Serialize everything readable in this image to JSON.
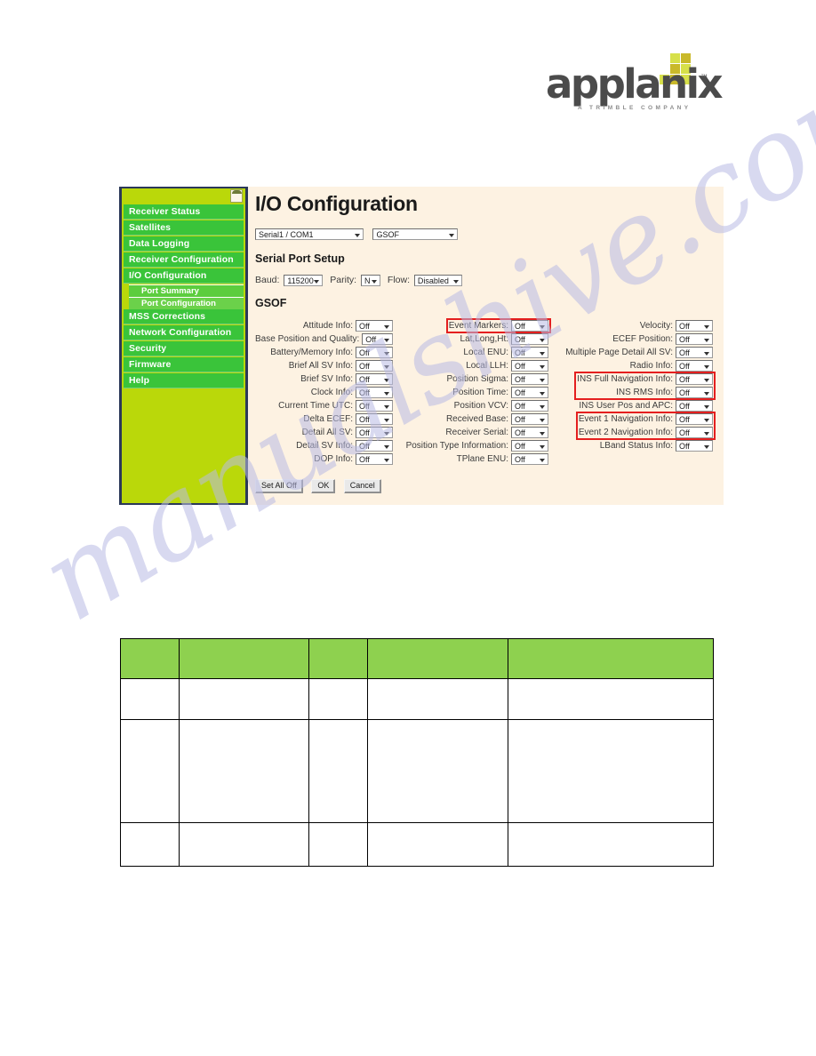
{
  "logo": {
    "wordmark": "applanix",
    "trademark": "™",
    "tagline": "A TRIMBLE COMPANY",
    "block_color_light": "#d7e04a",
    "block_color_dark": "#c9b92a"
  },
  "watermark": {
    "text": "manualshive.com",
    "color": "#b9bbe4"
  },
  "sidebar": {
    "background_color": "#bad80a",
    "item_color": "#3ac43a",
    "items": [
      {
        "label": "Receiver Status",
        "type": "item"
      },
      {
        "label": "Satellites",
        "type": "item"
      },
      {
        "label": "Data Logging",
        "type": "item"
      },
      {
        "label": "Receiver Configuration",
        "type": "item"
      },
      {
        "label": "I/O Configuration",
        "type": "item"
      },
      {
        "label": "Port Summary",
        "type": "sub"
      },
      {
        "label": "Port Configuration",
        "type": "sub-selected"
      },
      {
        "label": "MSS Corrections",
        "type": "item"
      },
      {
        "label": "Network Configuration",
        "type": "item"
      },
      {
        "label": "Security",
        "type": "item"
      },
      {
        "label": "Firmware",
        "type": "item"
      },
      {
        "label": "Help",
        "type": "item"
      }
    ]
  },
  "main": {
    "title": "I/O Configuration",
    "port_select": "Serial1 / COM1",
    "format_select": "GSOF",
    "serial_section_title": "Serial Port Setup",
    "baud_label": "Baud:",
    "baud_value": "115200",
    "parity_label": "Parity:",
    "parity_value": "N",
    "flow_label": "Flow:",
    "flow_value": "Disabled",
    "gsof_section_title": "GSOF",
    "off_value": "Off",
    "columns": [
      {
        "rows": [
          {
            "label": "Attitude Info:",
            "value": "Off",
            "highlight": false
          },
          {
            "label": "Base Position and Quality:",
            "value": "Off",
            "highlight": false
          },
          {
            "label": "Battery/Memory Info:",
            "value": "Off",
            "highlight": false
          },
          {
            "label": "Brief All SV Info:",
            "value": "Off",
            "highlight": false
          },
          {
            "label": "Brief SV Info:",
            "value": "Off",
            "highlight": false
          },
          {
            "label": "Clock Info:",
            "value": "Off",
            "highlight": false
          },
          {
            "label": "Current Time UTC:",
            "value": "Off",
            "highlight": false
          },
          {
            "label": "Delta ECEF:",
            "value": "Off",
            "highlight": false
          },
          {
            "label": "Detail All SV:",
            "value": "Off",
            "highlight": false
          },
          {
            "label": "Detail SV Info:",
            "value": "Off",
            "highlight": false
          },
          {
            "label": "DOP Info:",
            "value": "Off",
            "highlight": false
          }
        ]
      },
      {
        "rows": [
          {
            "label": "Event Markers:",
            "value": "Off",
            "highlight": true
          },
          {
            "label": "Lat,Long,Ht:",
            "value": "Off",
            "highlight": false
          },
          {
            "label": "Local ENU:",
            "value": "Off",
            "highlight": false
          },
          {
            "label": "Local LLH:",
            "value": "Off",
            "highlight": false
          },
          {
            "label": "Position Sigma:",
            "value": "Off",
            "highlight": false
          },
          {
            "label": "Position Time:",
            "value": "Off",
            "highlight": false
          },
          {
            "label": "Position VCV:",
            "value": "Off",
            "highlight": false
          },
          {
            "label": "Received Base:",
            "value": "Off",
            "highlight": false
          },
          {
            "label": "Receiver Serial:",
            "value": "Off",
            "highlight": false
          },
          {
            "label": "Position Type Information:",
            "value": "Off",
            "highlight": false
          },
          {
            "label": "TPlane ENU:",
            "value": "Off",
            "highlight": false
          }
        ]
      },
      {
        "rows": [
          {
            "label": "Velocity:",
            "value": "Off",
            "highlight": false
          },
          {
            "label": "ECEF Position:",
            "value": "Off",
            "highlight": false
          },
          {
            "label": "Multiple Page Detail All SV:",
            "value": "Off",
            "highlight": false
          },
          {
            "label": "Radio Info:",
            "value": "Off",
            "highlight": false
          },
          {
            "label": "INS Full Navigation Info:",
            "value": "Off",
            "highlight": true
          },
          {
            "label": "INS RMS Info:",
            "value": "Off",
            "highlight": true
          },
          {
            "label": "INS User Pos and APC:",
            "value": "Off",
            "highlight": false
          },
          {
            "label": "Event 1 Navigation Info:",
            "value": "Off",
            "highlight": true
          },
          {
            "label": "Event 2 Navigation Info:",
            "value": "Off",
            "highlight": true
          },
          {
            "label": "LBand Status Info:",
            "value": "Off",
            "highlight": false
          }
        ]
      }
    ],
    "buttons": {
      "set_all_off": "Set All Off",
      "ok": "OK",
      "cancel": "Cancel"
    },
    "highlight_color": "#e41f1f"
  },
  "bottom_table": {
    "header_color": "#8ed14f",
    "columns": 5,
    "header_cells": [
      "",
      "",
      "",
      "",
      ""
    ],
    "rows": [
      [
        "",
        "",
        "",
        "",
        ""
      ],
      [
        "",
        "",
        "",
        "",
        ""
      ],
      [
        "",
        "",
        "",
        "",
        ""
      ]
    ]
  }
}
